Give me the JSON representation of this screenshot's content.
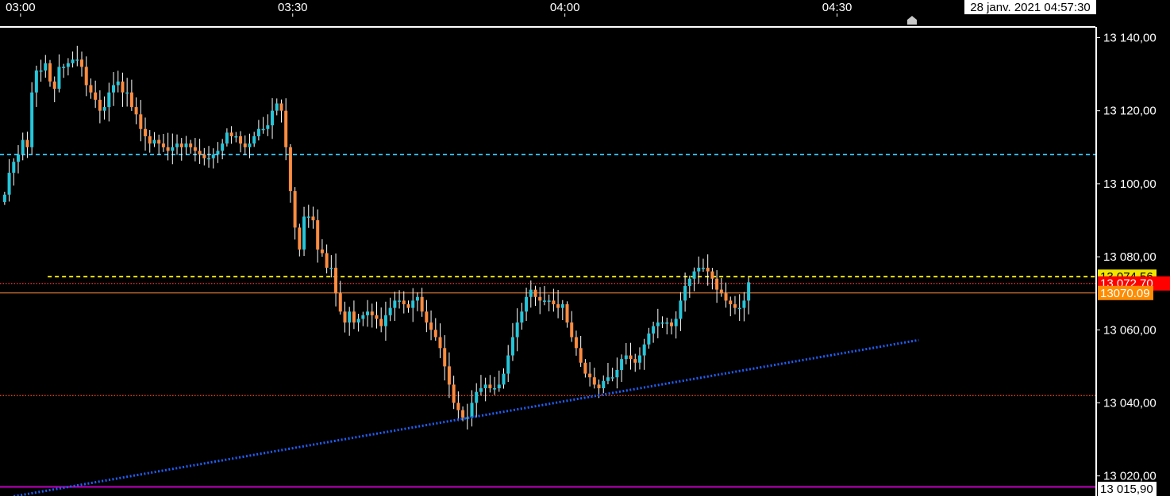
{
  "chart_data": {
    "type": "candlestick",
    "x_ticks": [
      "03:00",
      "03:30",
      "04:00",
      "04:30"
    ],
    "cursor_time": "28 janv. 2021 04:57:30",
    "y_ticks": [
      "13 140,00",
      "13 120,00",
      "13 100,00",
      "13 080,00",
      "13 060,00",
      "13 040,00",
      "13 020,00"
    ],
    "y_tick_values": [
      13140,
      13120,
      13100,
      13080,
      13060,
      13040,
      13020
    ],
    "ylim": [
      13014.5,
      13142.5
    ],
    "price_tags": [
      {
        "name": "level_yellow",
        "value": 13074.56,
        "label": "13 074,56",
        "bg": "#f2e600",
        "fg": "#000000"
      },
      {
        "name": "current",
        "value": 13072.7,
        "label": "13 072,70",
        "bg": "#ff0000",
        "fg": "#ffffff"
      },
      {
        "name": "orange",
        "value": 13070.09,
        "label": "13070.09",
        "bg": "#ff8c00",
        "fg": "#ffffff"
      },
      {
        "name": "low",
        "value": 13015.9,
        "label": "13 015,90",
        "bg": "#ffffff",
        "fg": "#000000"
      }
    ],
    "horizontal_lines": [
      {
        "value": 13108.0,
        "color": "#29b6f6",
        "style": "dashed",
        "from": "left"
      },
      {
        "value": 13074.56,
        "color": "#f2e600",
        "style": "dashed",
        "from": "03:03"
      },
      {
        "value": 13072.7,
        "color": "#ff3030",
        "style": "dotted",
        "from": "left"
      },
      {
        "value": 13070.09,
        "color": "#ff8c40",
        "style": "solid",
        "from": "left"
      },
      {
        "value": 13042.0,
        "color": "#ff5020",
        "style": "dotted",
        "from": "left"
      },
      {
        "value": 13017.0,
        "color": "#c000c0",
        "style": "solid",
        "from": "left"
      }
    ],
    "trendline": {
      "color": "#2060ff",
      "style": "dotted",
      "start": {
        "t": 2.5,
        "v": 13014.4
      },
      "end": {
        "t": 202,
        "v": 13057.2
      }
    },
    "bar_minutes": 0.5,
    "start_time": "02:58:00",
    "up_color": "#26c6da",
    "down_color": "#ff8c40",
    "wick_color": "#ffffff",
    "closes": [
      13097,
      13103,
      13106,
      13108,
      13112,
      13110,
      13125,
      13131,
      13131,
      13133,
      13128,
      13126,
      13132,
      13132,
      13133,
      13134,
      13134,
      13132,
      13127,
      13125,
      13123,
      13120,
      13121,
      13125,
      13127,
      13128,
      13125,
      13125,
      13121,
      13119,
      13115,
      13113,
      13111,
      13112,
      13111,
      13110,
      13109,
      13110,
      13111,
      13110,
      13111,
      13110,
      13109,
      13108,
      13107,
      13107,
      13108,
      13109,
      13111,
      13114,
      13113,
      13113,
      13111,
      13110,
      13111,
      13113,
      13115,
      13115,
      13116,
      13120,
      13122,
      13120,
      13110,
      13098,
      13088,
      13082,
      13091,
      13091,
      13090,
      13082,
      13081,
      13077,
      13077,
      13070,
      13065,
      13062,
      13065,
      13062,
      13063,
      13064,
      13065,
      13064,
      13063,
      13061,
      13064,
      13066,
      13068,
      13068,
      13067,
      13066,
      13068,
      13069,
      13065,
      13062,
      13060,
      13058,
      13055,
      13050,
      13045,
      13040,
      13038,
      13036,
      13036,
      13040,
      13043,
      13044,
      13045,
      13044,
      13044,
      13045,
      13048,
      13053,
      13058,
      13062,
      13065,
      13069,
      13071,
      13069,
      13068,
      13068,
      13068,
      13067,
      13066,
      13067,
      13062,
      13058,
      13055,
      13051,
      13048,
      13047,
      13045,
      13044,
      13046,
      13047,
      13047,
      13049,
      13052,
      13053,
      13052,
      13051,
      13053,
      13056,
      13059,
      13061,
      13062,
      13062,
      13062,
      13061,
      13063,
      13068,
      13072,
      13074,
      13076,
      13077,
      13077,
      13076,
      13074,
      13071,
      13070,
      13068,
      13067,
      13066,
      13066,
      13068,
      13073
    ]
  }
}
